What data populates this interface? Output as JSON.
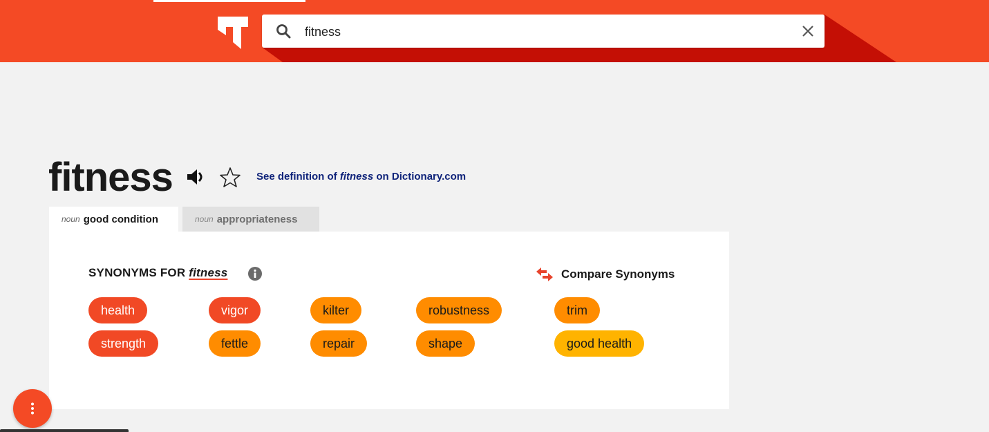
{
  "search": {
    "query": "fitness",
    "icon": "search-icon",
    "clear_icon": "close-icon"
  },
  "logo": {
    "icon": "thesaurus-logo-icon"
  },
  "colors": {
    "brand": "#f44a25",
    "relevance_high": "#f14925",
    "relevance_medium": "#ff8c00",
    "relevance_low": "#ffb300",
    "link": "#10247a"
  },
  "word": {
    "title": "fitness",
    "speaker_icon": "speaker-icon",
    "star_icon": "star-icon",
    "definition_link": {
      "prefix": "See definition of ",
      "word": "fitness",
      "suffix": " on Dictionary.com"
    }
  },
  "tabs": [
    {
      "pos": "noun",
      "sense": "good condition",
      "active": true
    },
    {
      "pos": "noun",
      "sense": "appropriateness",
      "active": false
    }
  ],
  "synonyms": {
    "heading_prefix": "SYNONYMS FOR ",
    "headword": "fitness",
    "info_icon": "info-icon",
    "compare_label": "Compare Synonyms",
    "compare_icon": "compare-arrows-icon",
    "items": [
      {
        "word": "health",
        "relevance": "high"
      },
      {
        "word": "vigor",
        "relevance": "high"
      },
      {
        "word": "kilter",
        "relevance": "medium"
      },
      {
        "word": "robustness",
        "relevance": "medium"
      },
      {
        "word": "trim",
        "relevance": "medium"
      },
      {
        "word": "strength",
        "relevance": "high"
      },
      {
        "word": "fettle",
        "relevance": "medium"
      },
      {
        "word": "repair",
        "relevance": "medium"
      },
      {
        "word": "shape",
        "relevance": "medium"
      },
      {
        "word": "good health",
        "relevance": "low"
      }
    ]
  },
  "fab": {
    "icon": "more-vertical-icon"
  }
}
